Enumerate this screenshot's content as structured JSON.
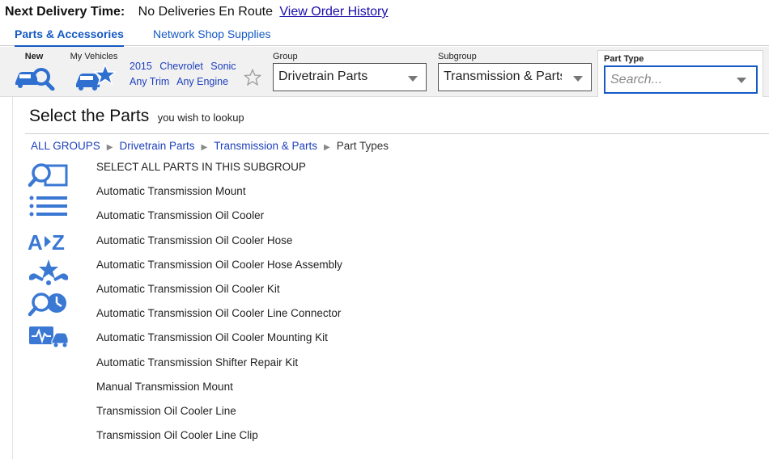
{
  "delivery": {
    "label": "Next Delivery Time:",
    "status": "No Deliveries En Route",
    "history_link": "View Order History"
  },
  "tabs": [
    {
      "label": "Parts & Accessories",
      "active": true
    },
    {
      "label": "Network Shop Supplies",
      "active": false
    }
  ],
  "toolbar": {
    "new_label": "New",
    "my_vehicles_label": "My Vehicles",
    "vehicle": {
      "year": "2015",
      "make": "Chevrolet",
      "model": "Sonic",
      "trim": "Any Trim",
      "engine": "Any Engine"
    },
    "group": {
      "label": "Group",
      "value": "Drivetrain Parts"
    },
    "subgroup": {
      "label": "Subgroup",
      "value": "Transmission & Parts"
    },
    "part_type": {
      "label": "Part Type",
      "placeholder": "Search..."
    }
  },
  "main": {
    "title": "Select the Parts",
    "subtitle": "you wish to lookup",
    "breadcrumb": [
      {
        "label": "ALL GROUPS",
        "link": true
      },
      {
        "label": "Drivetrain Parts",
        "link": true
      },
      {
        "label": "Transmission & Parts",
        "link": true
      },
      {
        "label": "Part Types",
        "link": false
      }
    ],
    "side_icons": [
      "parts-lookup-icon",
      "list-icon",
      "a-to-z-icon",
      "tools-star-icon",
      "search-clock-icon",
      "car-diagnostics-icon"
    ],
    "parts": [
      "SELECT ALL PARTS IN THIS SUBGROUP",
      "Automatic Transmission Mount",
      "Automatic Transmission Oil Cooler",
      "Automatic Transmission Oil Cooler Hose",
      "Automatic Transmission Oil Cooler Hose Assembly",
      "Automatic Transmission Oil Cooler Kit",
      "Automatic Transmission Oil Cooler Line Connector",
      "Automatic Transmission Oil Cooler Mounting Kit",
      "Automatic Transmission Shifter Repair Kit",
      "Manual Transmission Mount",
      "Transmission Oil Cooler Line",
      "Transmission Oil Cooler Line Clip"
    ]
  },
  "colors": {
    "accent": "#1459c4",
    "link": "#1d3fbd",
    "icon": "#3a78d4",
    "toolbar_bg": "#f1f1f1"
  }
}
